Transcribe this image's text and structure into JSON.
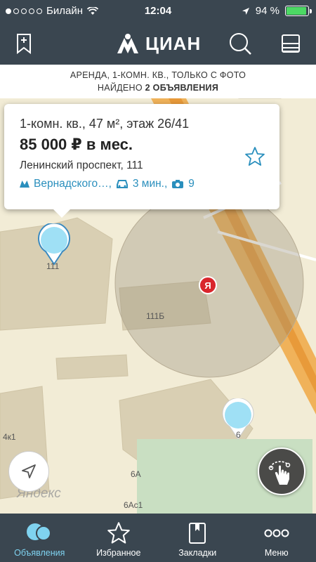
{
  "status_bar": {
    "carrier": "Билайн",
    "time": "12:04",
    "battery_percent": "94 %",
    "battery_level": 0.94
  },
  "header": {
    "logo_text": "ЦИАН"
  },
  "banner": {
    "line1": "АРЕНДА, 1-КОМН. КВ., ТОЛЬКО С ФОТО",
    "found_prefix": "НАЙДЕНО ",
    "found_count": "2 ОБЪЯВЛЕНИЯ"
  },
  "listing_card": {
    "title": "1-комн. кв., 47 м², этаж 26/41",
    "price": "85 000 ₽ в мес.",
    "address": "Ленинский проспект, 111",
    "metro": "Вернадского…,",
    "travel_time": "3 мин.,",
    "photo_count": "9"
  },
  "map": {
    "labels": {
      "b111": "111",
      "b111b": "111Б",
      "b4k1": "4к1",
      "b6a": "6А",
      "b6ac1": "6Ас1",
      "b6": "6"
    },
    "yandex_watermark": "Яндекс",
    "yandex_logo": "Я",
    "pin_color": "#9fe0f5"
  },
  "tabs": [
    {
      "label": "Объявления",
      "icon": "listings-icon",
      "active": true
    },
    {
      "label": "Избранное",
      "icon": "star-icon",
      "active": false
    },
    {
      "label": "Закладки",
      "icon": "bookmark-icon",
      "active": false
    },
    {
      "label": "Меню",
      "icon": "menu-dots-icon",
      "active": false
    }
  ],
  "colors": {
    "header_bg": "#3a4650",
    "accent": "#2a8fbd",
    "tab_active": "#7fd3f0"
  }
}
